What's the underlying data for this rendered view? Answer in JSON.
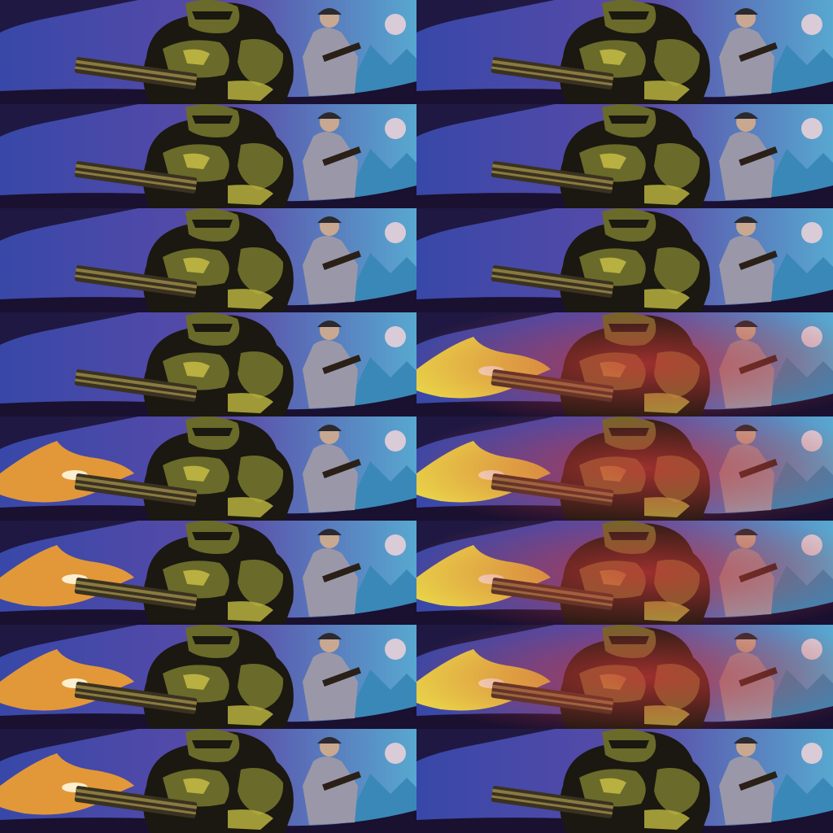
{
  "sprite_sheet": {
    "columns": 2,
    "rows": 8,
    "palette": {
      "sky_blue": "#3848a8",
      "sky_purple": "#5a4aa8",
      "sky_cyan": "#58a8d0",
      "armor_olive": "#6a6a2a",
      "armor_highlight": "#b8b040",
      "armor_dark": "#1a1810",
      "soldier_grey": "#9a98a8",
      "moon": "#e8d0d8",
      "flash_orange": "#f0a030",
      "flash_yellow": "#f8e040",
      "glow_red": "#c83838",
      "ground": "#1a1030"
    },
    "frames": [
      {
        "muzzle_flash": "none",
        "red_glow": false
      },
      {
        "muzzle_flash": "none",
        "red_glow": false
      },
      {
        "muzzle_flash": "none",
        "red_glow": false
      },
      {
        "muzzle_flash": "none",
        "red_glow": false
      },
      {
        "muzzle_flash": "none",
        "red_glow": false
      },
      {
        "muzzle_flash": "none",
        "red_glow": false
      },
      {
        "muzzle_flash": "none",
        "red_glow": false
      },
      {
        "muzzle_flash": "yellow",
        "red_glow": true
      },
      {
        "muzzle_flash": "orange",
        "red_glow": false
      },
      {
        "muzzle_flash": "yellow",
        "red_glow": true
      },
      {
        "muzzle_flash": "orange",
        "red_glow": false
      },
      {
        "muzzle_flash": "yellow",
        "red_glow": true
      },
      {
        "muzzle_flash": "orange",
        "red_glow": false
      },
      {
        "muzzle_flash": "yellow",
        "red_glow": true
      },
      {
        "muzzle_flash": "orange",
        "red_glow": false
      },
      {
        "muzzle_flash": "none",
        "red_glow": false
      }
    ]
  }
}
